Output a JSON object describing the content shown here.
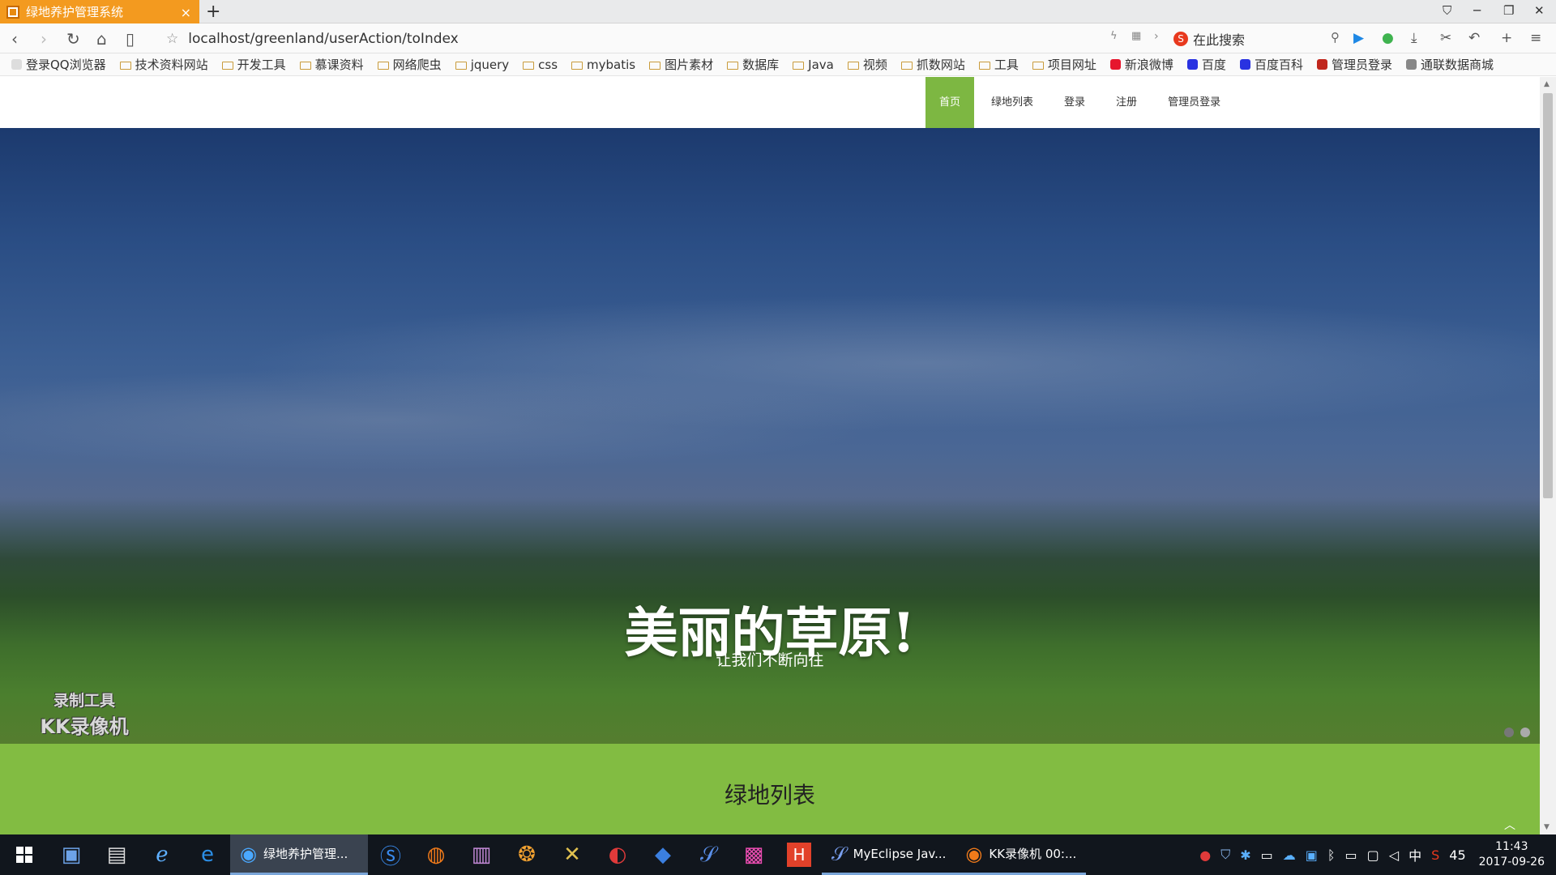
{
  "browser": {
    "tab_title": "绿地养护管理系统",
    "url": "localhost/greenland/userAction/toIndex",
    "search_placeholder": "在此搜索",
    "bookmarks": [
      {
        "label": "登录QQ浏览器",
        "kind": "site",
        "color": "#dddddd"
      },
      {
        "label": "技术资料网站",
        "kind": "folder"
      },
      {
        "label": "开发工具",
        "kind": "folder"
      },
      {
        "label": "慕课资料",
        "kind": "folder"
      },
      {
        "label": "网络爬虫",
        "kind": "folder"
      },
      {
        "label": "jquery",
        "kind": "folder"
      },
      {
        "label": "css",
        "kind": "folder"
      },
      {
        "label": "mybatis",
        "kind": "folder"
      },
      {
        "label": "图片素材",
        "kind": "folder"
      },
      {
        "label": "数据库",
        "kind": "folder"
      },
      {
        "label": "Java",
        "kind": "folder"
      },
      {
        "label": "视频",
        "kind": "folder"
      },
      {
        "label": "抓数网站",
        "kind": "folder"
      },
      {
        "label": "工具",
        "kind": "folder"
      },
      {
        "label": "项目网址",
        "kind": "folder"
      },
      {
        "label": "新浪微博",
        "kind": "site",
        "color": "#e6162d"
      },
      {
        "label": "百度",
        "kind": "site",
        "color": "#2932e1"
      },
      {
        "label": "百度百科",
        "kind": "site",
        "color": "#2932e1"
      },
      {
        "label": "管理员登录",
        "kind": "site",
        "color": "#c0261c"
      },
      {
        "label": "通联数据商城",
        "kind": "site",
        "color": "#888888"
      }
    ]
  },
  "site": {
    "menu": [
      {
        "label": "首页",
        "active": true
      },
      {
        "label": "绿地列表",
        "active": false
      },
      {
        "label": "登录",
        "active": false
      },
      {
        "label": "注册",
        "active": false
      },
      {
        "label": "管理员登录",
        "active": false
      }
    ],
    "hero": {
      "title": "美丽的草原!",
      "subtitle": "让我们不断向往"
    },
    "section_title": "绿地列表",
    "accent_color": "#7db742"
  },
  "watermark": {
    "line1": "录制工具",
    "line2": "KK录像机"
  },
  "taskbar": {
    "apps": [
      {
        "label": "绿地养护管理...",
        "active": true
      },
      {
        "label": "MyEclipse Jav...",
        "active": false
      },
      {
        "label": "KK录像机 00:...",
        "active": false
      }
    ],
    "ime": "中",
    "volume_level": "45",
    "time": "11:43",
    "date": "2017-09-26"
  }
}
